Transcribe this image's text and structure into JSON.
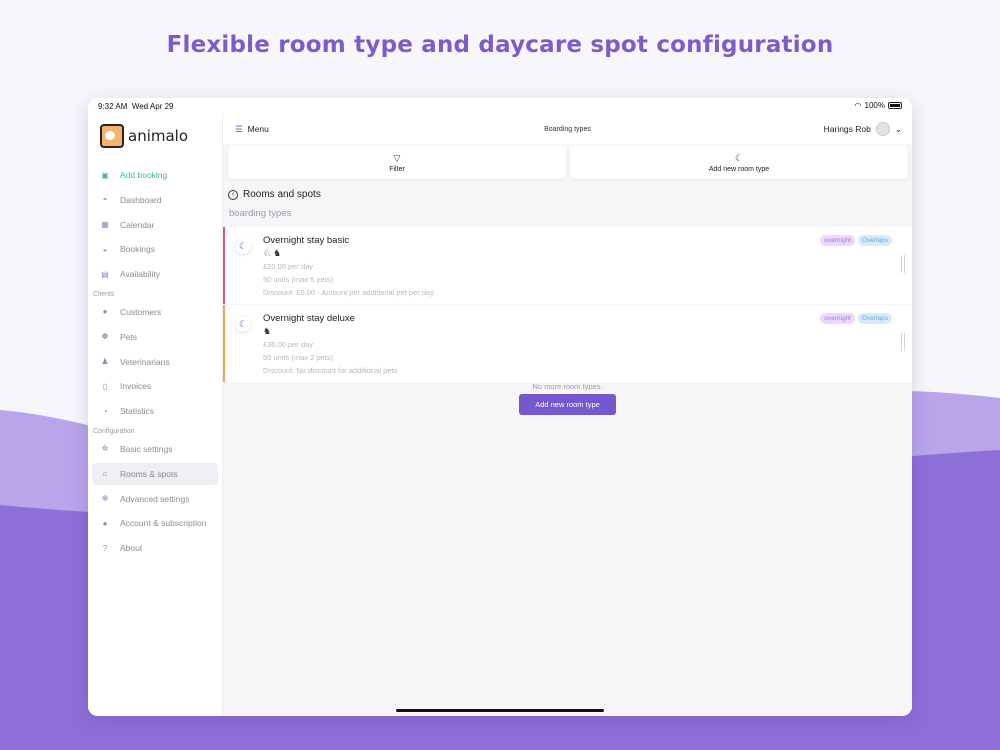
{
  "headline": "Flexible room type and daycare spot configuration",
  "colors": {
    "accent": "#7458cf",
    "headline": "#7b5cc9",
    "add_green": "#45b97f",
    "wave": "#8e6fd8"
  },
  "status": {
    "time": "9:32 AM",
    "date": "Wed Apr 29",
    "battery": "100%"
  },
  "logo": {
    "text": "animalo"
  },
  "sidebar": {
    "items": [
      {
        "label": "Add booking",
        "icon": "plus-square-icon"
      },
      {
        "label": "Dashboard",
        "icon": "gauge-icon"
      },
      {
        "label": "Calendar",
        "icon": "calendar-icon"
      },
      {
        "label": "Bookings",
        "icon": "bookings-icon"
      },
      {
        "label": "Availability",
        "icon": "availability-icon"
      }
    ],
    "section_clients": "Clients",
    "clients": [
      {
        "label": "Customers",
        "icon": "user-icon"
      },
      {
        "label": "Pets",
        "icon": "paw-icon"
      },
      {
        "label": "Veterinarians",
        "icon": "vet-icon"
      },
      {
        "label": "Invoices",
        "icon": "invoice-icon"
      },
      {
        "label": "Statistics",
        "icon": "statistics-icon"
      }
    ],
    "section_config": "Configuration",
    "config": [
      {
        "label": "Basic settings",
        "icon": "gear-icon"
      },
      {
        "label": "Rooms & spots",
        "icon": "rooms-icon"
      },
      {
        "label": "Advanced settings",
        "icon": "gears-icon"
      },
      {
        "label": "Account & subscription",
        "icon": "account-icon"
      },
      {
        "label": "About",
        "icon": "question-icon"
      }
    ]
  },
  "topbar": {
    "menu_label": "Menu",
    "title": "Boarding types",
    "user_name": "Harings Rob"
  },
  "actions": {
    "filter": "Filter",
    "add_room_type": "Add new room type"
  },
  "back_label": "Rooms and spots",
  "subheading": "boarding types",
  "rooms": [
    {
      "name": "Overnight stay basic",
      "price": "£20.00 per day",
      "units": "50 units (max 5 pets)",
      "discount": "Discount: £5.00 - Amount per additional pet per day",
      "badges": [
        "overnight",
        "Overlaps"
      ],
      "stripe": "#e0547a"
    },
    {
      "name": "Overnight stay deluxe",
      "price": "£30.00 per day",
      "units": "50 units (max 2 pets)",
      "discount": "Discount: No discount for additional pets",
      "badges": [
        "overnight",
        "Overlaps"
      ],
      "stripe": "#f0a54a"
    }
  ],
  "no_more": "No more room types.",
  "add_button": "Add new room type"
}
